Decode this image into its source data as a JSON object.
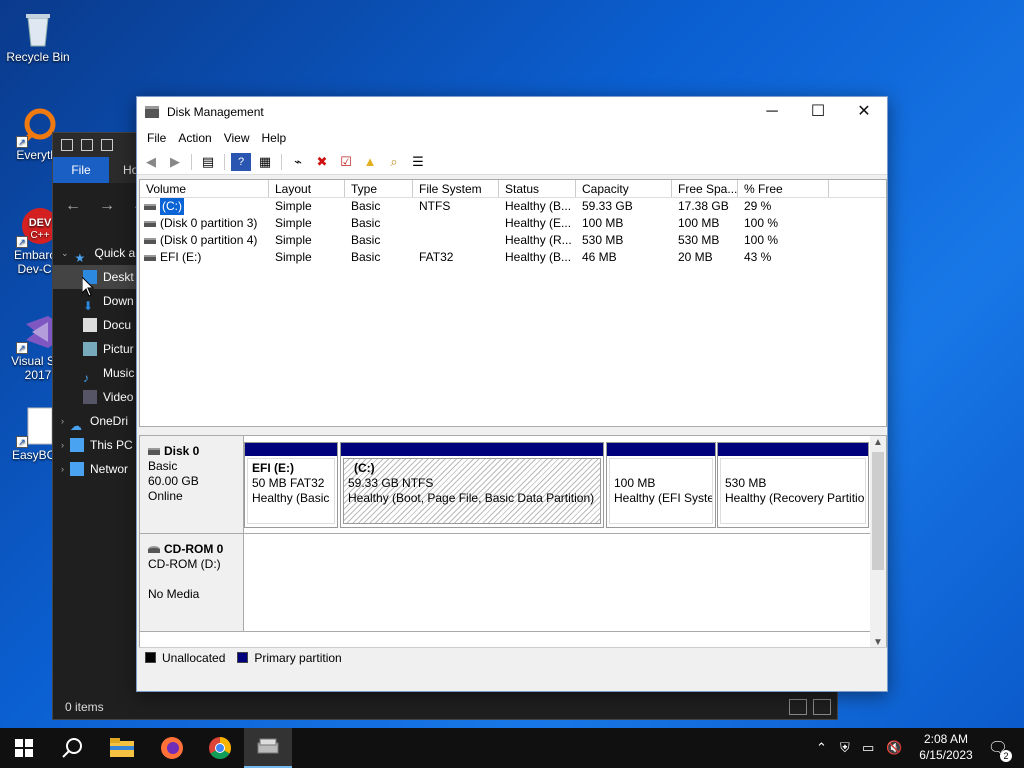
{
  "desktop": {
    "icons": [
      {
        "label": "Recycle Bin"
      },
      {
        "label": "Everythi"
      },
      {
        "label": "Embarca Dev-C+"
      },
      {
        "label": "Visual Stu 2017"
      },
      {
        "label": "EasyBCD"
      }
    ]
  },
  "explorer": {
    "ribbon_file": "File",
    "ribbon_home": "Ho",
    "nav": [
      "Quick a",
      "Deskt",
      "Down",
      "Docu",
      "Pictur",
      "Music",
      "Video",
      "OneDri",
      "This PC",
      "Networ"
    ],
    "status": "0 items"
  },
  "disk_mgmt": {
    "title": "Disk Management",
    "menu": [
      "File",
      "Action",
      "View",
      "Help"
    ],
    "columns": [
      "Volume",
      "Layout",
      "Type",
      "File System",
      "Status",
      "Capacity",
      "Free Spa...",
      "% Free"
    ],
    "volumes": [
      {
        "volume": "(C:)",
        "layout": "Simple",
        "type": "Basic",
        "fs": "NTFS",
        "status": "Healthy (B...",
        "capacity": "59.33 GB",
        "free": "17.38 GB",
        "pct": "29 %"
      },
      {
        "volume": "(Disk 0 partition 3)",
        "layout": "Simple",
        "type": "Basic",
        "fs": "",
        "status": "Healthy (E...",
        "capacity": "100 MB",
        "free": "100 MB",
        "pct": "100 %"
      },
      {
        "volume": "(Disk 0 partition 4)",
        "layout": "Simple",
        "type": "Basic",
        "fs": "",
        "status": "Healthy (R...",
        "capacity": "530 MB",
        "free": "530 MB",
        "pct": "100 %"
      },
      {
        "volume": "EFI (E:)",
        "layout": "Simple",
        "type": "Basic",
        "fs": "FAT32",
        "status": "Healthy (B...",
        "capacity": "46 MB",
        "free": "20 MB",
        "pct": "43 %"
      }
    ],
    "disk0": {
      "name": "Disk 0",
      "type": "Basic",
      "size": "60.00 GB",
      "state": "Online",
      "partitions": [
        {
          "name": "EFI  (E:)",
          "size": "50 MB FAT32",
          "status": "Healthy (Basic"
        },
        {
          "name": "(C:)",
          "size": "59.33 GB NTFS",
          "status": "Healthy (Boot, Page File, Basic Data Partition)"
        },
        {
          "name": "",
          "size": "100 MB",
          "status": "Healthy (EFI Syster"
        },
        {
          "name": "",
          "size": "530 MB",
          "status": "Healthy (Recovery Partitio"
        }
      ]
    },
    "cdrom": {
      "name": "CD-ROM 0",
      "drive": "CD-ROM (D:)",
      "media": "No Media"
    },
    "legend": {
      "unallocated": "Unallocated",
      "primary": "Primary partition"
    }
  },
  "taskbar": {
    "time": "2:08 AM",
    "date": "6/15/2023",
    "notif_count": "2"
  },
  "colors": {
    "primary_partition": "#00007c",
    "selection": "#0a64d6"
  }
}
